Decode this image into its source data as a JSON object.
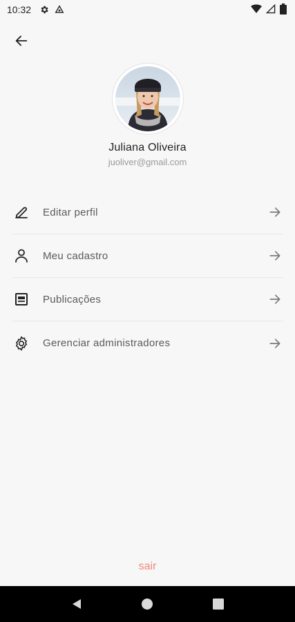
{
  "status_bar": {
    "time": "10:32",
    "icons": [
      "gear-icon",
      "sync-icon",
      "wifi-icon",
      "signal-icon",
      "battery-icon"
    ]
  },
  "header": {
    "back_icon": "arrow-left-icon"
  },
  "profile": {
    "name": "Juliana Oliveira",
    "email": "juoliver@gmail.com",
    "avatar": "avatar-photo"
  },
  "menu": {
    "items": [
      {
        "label": "Editar perfil",
        "icon": "pencil-icon"
      },
      {
        "label": "Meu cadastro",
        "icon": "user-icon"
      },
      {
        "label": "Publicações",
        "icon": "document-icon"
      },
      {
        "label": "Gerenciar administradores",
        "icon": "gear-icon"
      }
    ],
    "arrow_icon": "arrow-right-icon"
  },
  "logout": {
    "label": "sair"
  },
  "navigation_bar": {
    "icons": [
      "back-triangle-icon",
      "home-circle-icon",
      "recents-square-icon"
    ]
  },
  "colors": {
    "background": "#f7f7f7",
    "logout_text": "#f2877a",
    "label_text": "#5a5a5a",
    "email_text": "#9a9a9a",
    "divider": "#e7e7e7"
  }
}
